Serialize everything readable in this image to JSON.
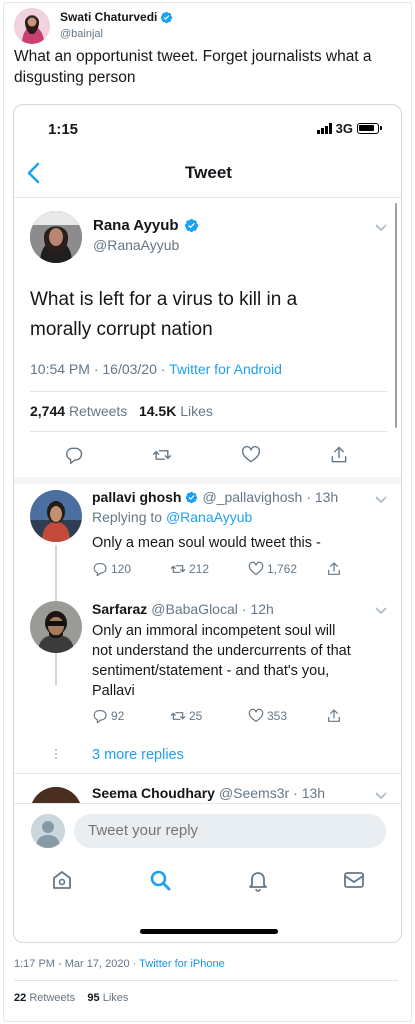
{
  "outer_tweet": {
    "author_name": "Swati Chaturvedi",
    "author_handle": "@bainjal",
    "text_line1": "What an opportunist tweet. Forget journalists what a",
    "text_line2": "disgusting person",
    "timestamp": "1:17 PM - Mar 17, 2020",
    "separator": " · ",
    "source": "Twitter for iPhone",
    "retweets_count": "22",
    "retweets_label": "Retweets",
    "likes_count": "95",
    "likes_label": "Likes"
  },
  "phone": {
    "status_time": "1:15",
    "network": "3G",
    "nav_title": "Tweet"
  },
  "main_tweet": {
    "author_name": "Rana Ayyub",
    "author_handle": "@RanaAyyub",
    "text_line1": "What is left for a virus to kill in a",
    "text_line2": "morally corrupt nation",
    "timestamp": "10:54 PM · 16/03/20 ·",
    "source": "Twitter for Android",
    "retweets_count": "2,744",
    "retweets_label": "Retweets",
    "likes_count": "14.5K",
    "likes_label": "Likes"
  },
  "replies": [
    {
      "name": "pallavi ghosh",
      "handle": "@_pallavighosh",
      "time": "· 13h",
      "replying_prefix": "Replying to",
      "replying_to": "@RanaAyyub",
      "text": "Only a mean soul would tweet this -",
      "replies": "120",
      "retweets": "212",
      "likes": "1,762"
    },
    {
      "name": "Sarfaraz",
      "handle": "@BabaGlocal",
      "time": "· 12h",
      "text_line1": "Only an immoral incompetent soul will",
      "text_line2": "not understand the undercurrents of that",
      "text_line3": "sentiment/statement - and that's you,",
      "text_line4": "Pallavi",
      "replies": "92",
      "retweets": "25",
      "likes": "353"
    },
    {
      "name": "Seema Choudhary",
      "handle": "@Seems3r",
      "time": "· 13h"
    }
  ],
  "more_replies": "3 more replies",
  "compose": {
    "placeholder": "Tweet your reply"
  },
  "colors": {
    "twitter_blue": "#1da1f2",
    "text": "#14171a",
    "secondary": "#657786"
  }
}
